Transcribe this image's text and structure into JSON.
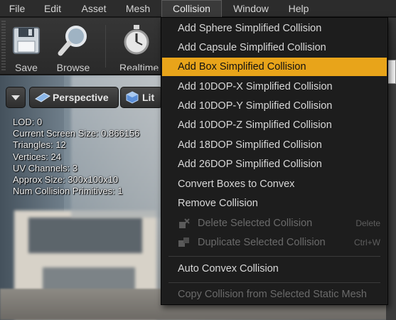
{
  "menubar": {
    "items": [
      {
        "label": "File"
      },
      {
        "label": "Edit"
      },
      {
        "label": "Asset"
      },
      {
        "label": "Mesh"
      },
      {
        "label": "Collision"
      },
      {
        "label": "Window"
      },
      {
        "label": "Help"
      }
    ],
    "open_menu": "Collision"
  },
  "toolbar": {
    "save_label": "Save",
    "browse_label": "Browse",
    "realtime_label": "Realtime"
  },
  "viewport": {
    "perspective_label": "Perspective",
    "lit_label": "Lit",
    "stats": [
      "LOD:  0",
      "Current Screen Size:  0.866156",
      "Triangles:  12",
      "Vertices:  24",
      "UV Channels:  3",
      "Approx Size: 300x100x10",
      "Num Collision Primitives:  1"
    ]
  },
  "collision_menu": {
    "items": [
      {
        "label": "Add Sphere Simplified Collision"
      },
      {
        "label": "Add Capsule Simplified Collision"
      },
      {
        "label": "Add Box Simplified Collision",
        "state": "highlighted"
      },
      {
        "label": "Add 10DOP-X Simplified Collision"
      },
      {
        "label": "Add 10DOP-Y Simplified Collision"
      },
      {
        "label": "Add 10DOP-Z Simplified Collision"
      },
      {
        "label": "Add 18DOP Simplified Collision"
      },
      {
        "label": "Add 26DOP Simplified Collision"
      },
      {
        "label": "Convert Boxes to Convex"
      },
      {
        "label": "Remove Collision"
      },
      {
        "label": "Delete Selected Collision",
        "shortcut": "Delete",
        "state": "disabled"
      },
      {
        "label": "Duplicate Selected Collision",
        "shortcut": "Ctrl+W",
        "state": "disabled"
      },
      {
        "label": "Auto Convex Collision"
      },
      {
        "label": "Copy Collision from Selected Static Mesh",
        "state": "disabled"
      }
    ],
    "highlight_color": "#e8a41a"
  }
}
